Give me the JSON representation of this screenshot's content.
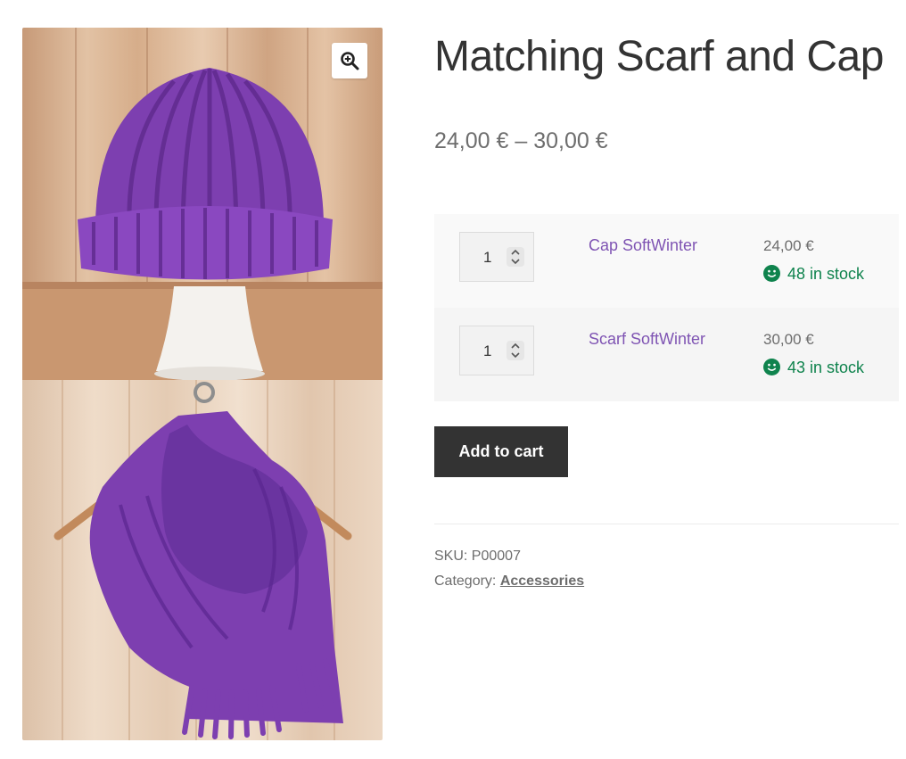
{
  "product": {
    "title": "Matching Scarf and Cap",
    "price_range": "24,00 € – 30,00 €"
  },
  "gallery": {
    "zoom_icon": "magnifier-plus-icon",
    "images": [
      "cap-photo",
      "scarf-photo"
    ]
  },
  "grouped_items": [
    {
      "quantity": "1",
      "name": "Cap SoftWinter",
      "price": "24,00 €",
      "stock": "48 in stock"
    },
    {
      "quantity": "1",
      "name": "Scarf SoftWinter",
      "price": "30,00 €",
      "stock": "43 in stock"
    }
  ],
  "actions": {
    "add_to_cart_label": "Add to cart"
  },
  "meta": {
    "sku_label": "SKU:",
    "sku_value": "P00007",
    "category_label": "Category:",
    "category_value": "Accessories"
  },
  "colors": {
    "link_purple": "#7f54b3",
    "stock_green": "#0f834d",
    "button_dark": "#333333",
    "product_purple": "#7d3fb0"
  }
}
